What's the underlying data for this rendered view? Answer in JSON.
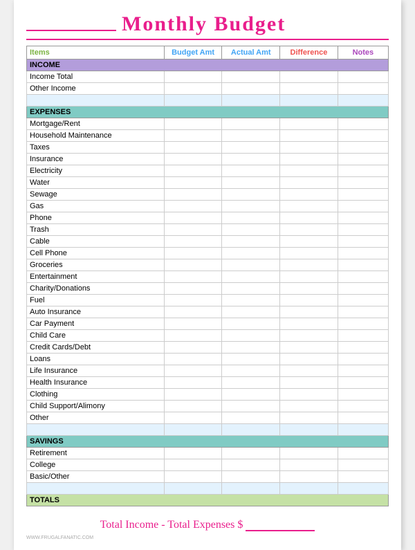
{
  "header": {
    "title": "Monthly Budget",
    "blank_label": "___________"
  },
  "columns": {
    "items": "Items",
    "budget": "Budget Amt",
    "actual": "Actual Amt",
    "difference": "Difference",
    "notes": "Notes"
  },
  "sections": {
    "income": {
      "label": "INCOME",
      "rows": [
        "Income Total",
        "Other Income",
        ""
      ]
    },
    "expenses": {
      "label": "EXPENSES",
      "rows": [
        "Mortgage/Rent",
        "Household Maintenance",
        "Taxes",
        "Insurance",
        "Electricity",
        "Water",
        "Sewage",
        "Gas",
        "Phone",
        "Trash",
        "Cable",
        "Cell Phone",
        "Groceries",
        "Entertainment",
        "Charity/Donations",
        "Fuel",
        "Auto Insurance",
        "Car Payment",
        "Child Care",
        "Credit Cards/Debt",
        "Loans",
        "Life Insurance",
        "Health Insurance",
        "Clothing",
        "Child Support/Alimony",
        "Other",
        ""
      ]
    },
    "savings": {
      "label": "SAVINGS",
      "rows": [
        "Retirement",
        "College",
        "Basic/Other",
        ""
      ]
    },
    "totals": {
      "label": "TOTALS"
    }
  },
  "footer": {
    "text": "Total Income - Total Expenses $",
    "blank": "_______"
  },
  "watermark": "WWW.FRUGALFANATIC.COM"
}
